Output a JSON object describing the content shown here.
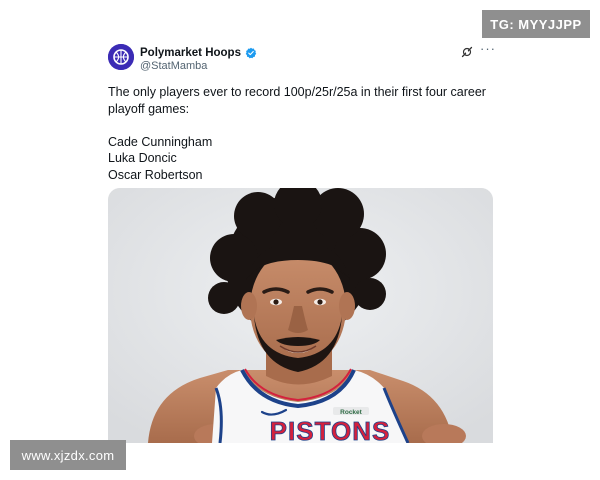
{
  "author": {
    "display_name": "Polymarket Hoops",
    "handle": "@StatMamba",
    "verified": true,
    "avatar_icon": "basketball-logo-icon",
    "avatar_color": "#3b2bb5"
  },
  "header_actions": {
    "grok_icon": "grok-icon",
    "more_icon": "more-options-icon"
  },
  "tweet": {
    "intro": "The only players ever to record 100p/25r/25a in their first four career playoff games:",
    "players": [
      "Cade Cunningham",
      "Luka Doncic",
      "Oscar Robertson"
    ]
  },
  "media": {
    "jersey_text": "PISTONS",
    "jersey_patch": "Rocket"
  },
  "watermarks": {
    "top": "TG: MYYJJPP",
    "bottom": "www.xjzdx.com"
  },
  "colors": {
    "verified": "#1d9bf0",
    "jersey_red": "#d4213d",
    "jersey_blue": "#1d428a"
  }
}
